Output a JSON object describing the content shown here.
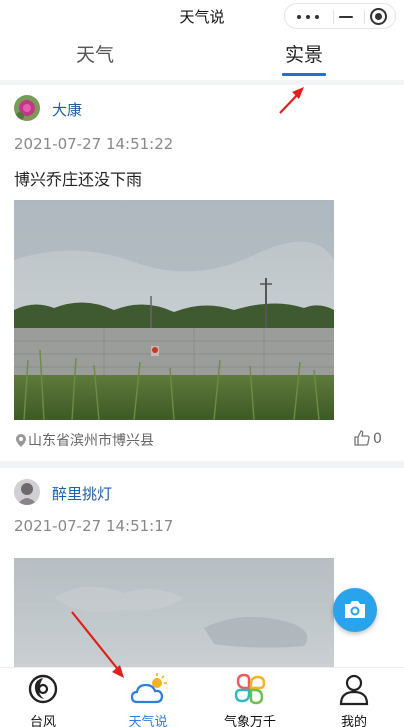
{
  "app": {
    "title": "天气说"
  },
  "tabs": [
    {
      "label": "天气",
      "active": false
    },
    {
      "label": "实景",
      "active": true
    }
  ],
  "posts": [
    {
      "user": "大康",
      "time": "2021-07-27 14:51:22",
      "caption": "博兴乔庄还没下雨",
      "location": "山东省滨州市博兴县",
      "likes": "0"
    },
    {
      "user": "醉里挑灯",
      "time": "2021-07-27 14:51:17"
    }
  ],
  "fab": {
    "icon": "camera-icon"
  },
  "tabbar": [
    {
      "label": "台风",
      "icon": "typhoon-icon",
      "active": false
    },
    {
      "label": "天气说",
      "icon": "cloud-sun-icon",
      "active": true
    },
    {
      "label": "气象万千",
      "icon": "clover-icon",
      "active": false
    },
    {
      "label": "我的",
      "icon": "user-icon",
      "active": false
    }
  ],
  "colors": {
    "accent": "#1f73c8",
    "username": "#1d5fa8",
    "active_tab": "#2f7fd8",
    "fab": "#29a3ea",
    "annotation_arrow": "#e0201a"
  }
}
